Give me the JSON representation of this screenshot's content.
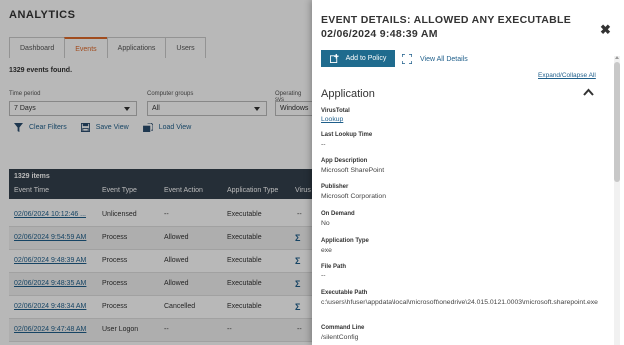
{
  "page": {
    "title": "ANALYTICS",
    "tabs": [
      {
        "label": "Dashboard"
      },
      {
        "label": "Events"
      },
      {
        "label": "Applications"
      },
      {
        "label": "Users"
      }
    ],
    "active_tab": "Events",
    "found_text": "1329 events found.",
    "filters": {
      "time_period_label": "Time period",
      "time_period_value": "7 Days",
      "computer_groups_label": "Computer groups",
      "computer_groups_value": "All",
      "operating_system_label": "Operating sys",
      "operating_system_value": "Windows"
    },
    "actions": {
      "clear": "Clear Filters",
      "save": "Save View",
      "load": "Load View"
    },
    "grid": {
      "count": "1329 items",
      "headers": [
        "Event Time",
        "Event Type",
        "Event Action",
        "Application Type",
        "Virus"
      ],
      "rows": [
        {
          "time": "02/06/2024 10:12:46 ...",
          "type": "Unlicensed",
          "action": "--",
          "app_type": "Executable",
          "virus": "--"
        },
        {
          "time": "02/06/2024 9:54:59 AM",
          "type": "Process",
          "action": "Allowed",
          "app_type": "Executable",
          "virus": "Σ"
        },
        {
          "time": "02/06/2024 9:48:39 AM",
          "type": "Process",
          "action": "Allowed",
          "app_type": "Executable",
          "virus": "Σ"
        },
        {
          "time": "02/06/2024 9:48:35 AM",
          "type": "Process",
          "action": "Allowed",
          "app_type": "Executable",
          "virus": "Σ"
        },
        {
          "time": "02/06/2024 9:48:34 AM",
          "type": "Process",
          "action": "Cancelled",
          "app_type": "Executable",
          "virus": "Σ"
        },
        {
          "time": "02/06/2024 9:47:48 AM",
          "type": "User Logon",
          "action": "--",
          "app_type": "--",
          "virus": "--"
        }
      ]
    }
  },
  "panel": {
    "title": "EVENT DETAILS: ALLOWED ANY EXECUTABLE 02/06/2024 9:48:39 AM",
    "close_symbol": "✖",
    "add_to_policy": "Add to Policy",
    "view_all_details": "View All Details",
    "expand_collapse": "Expand/Collapse All",
    "section_title": "Application",
    "fields": [
      {
        "label": "VirusTotal",
        "value": "Lookup",
        "is_link": true
      },
      {
        "label": "Last Lookup Time",
        "value": "--"
      },
      {
        "label": "App Description",
        "value": "Microsoft SharePoint"
      },
      {
        "label": "Publisher",
        "value": "Microsoft Corporation"
      },
      {
        "label": "On Demand",
        "value": "No"
      },
      {
        "label": "Application Type",
        "value": "exe"
      },
      {
        "label": "File Path",
        "value": "--"
      },
      {
        "label": "Executable Path",
        "value": "c:\\users\\hfuser\\appdata\\local\\microsoft\\onedrive\\24.015.0121.0003\\microsoft.sharepoint.exe"
      },
      {
        "label": "Command Line",
        "value": "/silentConfig"
      }
    ]
  },
  "colors": {
    "accent": "#e06a2a",
    "primary_button": "#1f6b8e",
    "link": "#1f5f8b",
    "grid_header": "#34404d"
  }
}
